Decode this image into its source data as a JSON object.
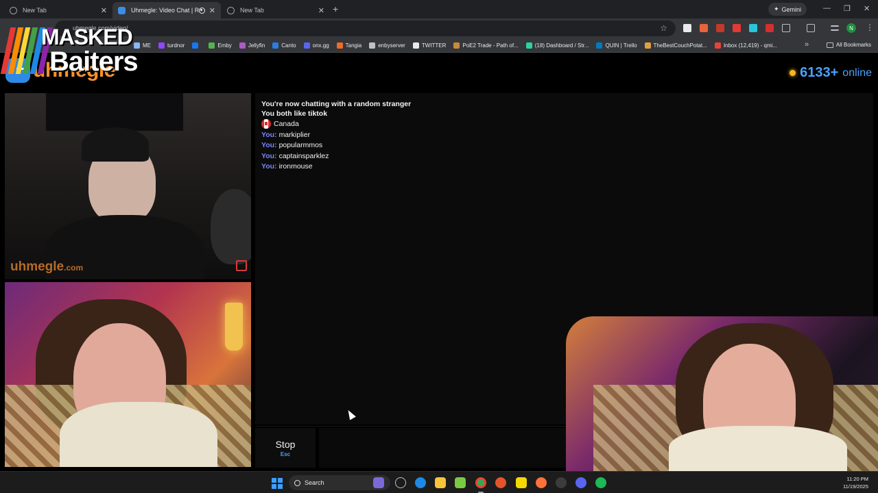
{
  "browser": {
    "tabs": [
      {
        "title": "New Tab",
        "active": false
      },
      {
        "title": "Uhmegle: Video Chat | Rand",
        "active": true
      },
      {
        "title": "New Tab",
        "active": false
      }
    ],
    "gemini_label": "Gemini",
    "url": "uhmegle.com/video/",
    "profile_initial": "N",
    "bookmarks": [
      {
        "label": "ME",
        "color": "#8ab4f8"
      },
      {
        "label": "turdnor",
        "color": "#9146ff"
      },
      {
        "label": "",
        "color": "#1877f2"
      },
      {
        "label": "Emby",
        "color": "#52b54b"
      },
      {
        "label": "Jellyfin",
        "color": "#aa5cc3"
      },
      {
        "label": "Canto",
        "color": "#2a7de1"
      },
      {
        "label": "onx.gg",
        "color": "#5865f2"
      },
      {
        "label": "Tangia",
        "color": "#f06a2a"
      },
      {
        "label": "enbyserver",
        "color": "#bdc1c6"
      },
      {
        "label": "TWITTER",
        "color": "#e8eaed"
      },
      {
        "label": "PoE2 Trade - Path of...",
        "color": "#c88a3a"
      },
      {
        "label": "(18) Dashboard / Str...",
        "color": "#2ad4a0"
      },
      {
        "label": "QUIN | Trello",
        "color": "#0079bf"
      },
      {
        "label": "TheBestCouchPotat...",
        "color": "#e0a040"
      },
      {
        "label": "Inbox (12,419) - qmi...",
        "color": "#ea4335"
      }
    ],
    "all_bookmarks_label": "All Bookmarks"
  },
  "overlay": {
    "brand_top": "MASKED",
    "brand_bottom": "Baiters"
  },
  "site": {
    "logo_text": "uhmegle",
    "online_count": "6133+",
    "online_label": "online",
    "watermark": "uhmegle",
    "watermark_suffix": ".com"
  },
  "chat": {
    "system_lines": [
      "You're now chatting with a random stranger",
      "You both like tiktok"
    ],
    "country": "Canada",
    "you_label": "You:",
    "messages": [
      "markiplier",
      "popularmmos",
      "captainsparklez",
      "ironmouse"
    ]
  },
  "controls": {
    "stop_label": "Stop",
    "stop_hotkey": "Esc"
  },
  "taskbar": {
    "search_label": "Search",
    "time": "11:20 PM",
    "date": "11/19/2025"
  },
  "colors": {
    "accent_blue": "#4aa3ff",
    "you_color": "#7a86ff",
    "logo_orange": "#f5922a"
  }
}
